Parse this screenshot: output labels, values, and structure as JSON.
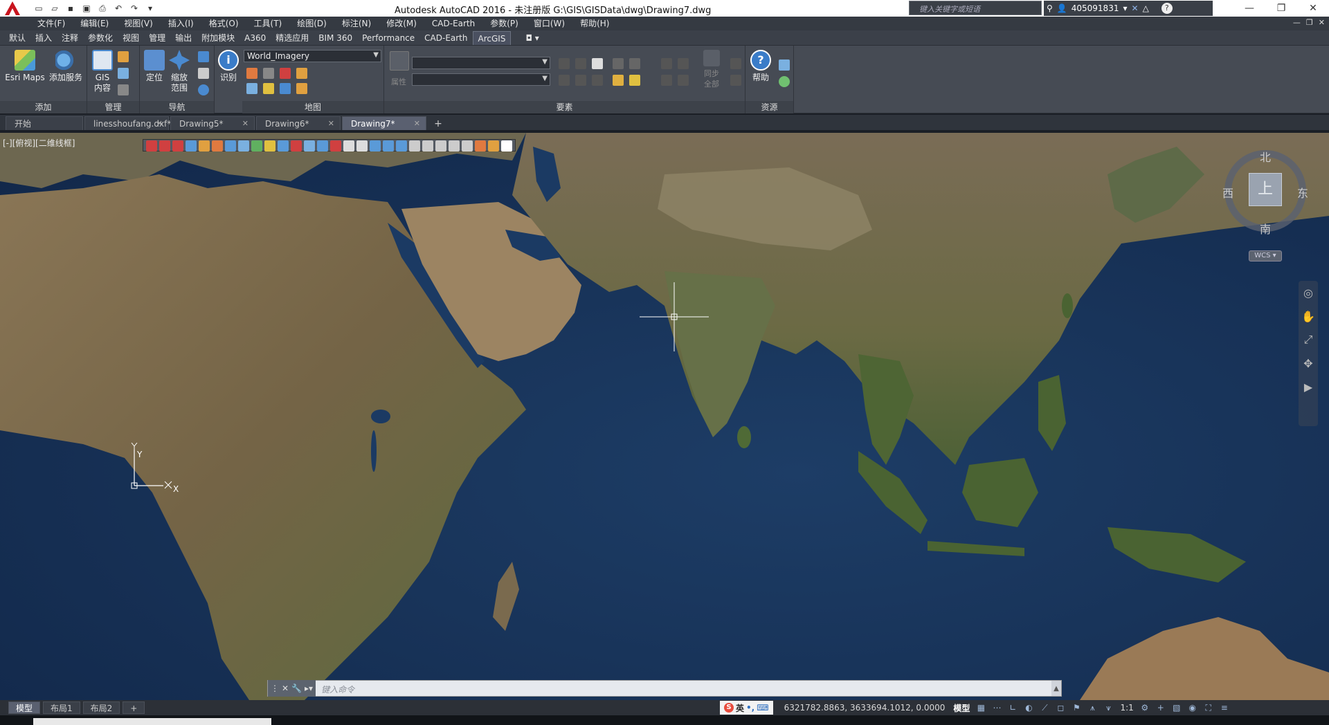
{
  "titlebar": {
    "title": "Autodesk AutoCAD 2016 - 未注册版    G:\\GIS\\GISData\\dwg\\Drawing7.dwg",
    "search_placeholder": "键入关键字或短语",
    "username": "405091831",
    "help_icon": "?"
  },
  "menubar": [
    "文件(F)",
    "编辑(E)",
    "视图(V)",
    "插入(I)",
    "格式(O)",
    "工具(T)",
    "绘图(D)",
    "标注(N)",
    "修改(M)",
    "CAD-Earth",
    "参数(P)",
    "窗口(W)",
    "帮助(H)"
  ],
  "ribbon_tabs": [
    "默认",
    "插入",
    "注释",
    "参数化",
    "视图",
    "管理",
    "输出",
    "附加模块",
    "A360",
    "精选应用",
    "BIM 360",
    "Performance",
    "CAD-Earth",
    "ArcGIS"
  ],
  "ribbon_active_tab": "ArcGIS",
  "ribbon": {
    "add_panel": {
      "title": "添加",
      "esri_maps": "Esri Maps",
      "add_service": "添加服务"
    },
    "manage_panel": {
      "title": "管理",
      "gis_content": "GIS\n内容"
    },
    "nav_panel": {
      "title": "导航",
      "locate": "定位",
      "zoom_extent": "缩放\n范围"
    },
    "identify": "识别",
    "map_panel": {
      "title": "地图",
      "basemap": "World_Imagery"
    },
    "features_panel": {
      "title": "要素",
      "attr_label": "属性",
      "sync_all": "同步\n全部"
    },
    "resources_panel": {
      "title": "资源",
      "help": "帮助"
    }
  },
  "file_tabs": [
    {
      "label": "开始",
      "active": false,
      "closable": false
    },
    {
      "label": "linesshoufang.dxf*",
      "active": false,
      "closable": true
    },
    {
      "label": "Drawing5*",
      "active": false,
      "closable": true
    },
    {
      "label": "Drawing6*",
      "active": false,
      "closable": true
    },
    {
      "label": "Drawing7*",
      "active": true,
      "closable": true
    }
  ],
  "viewport": {
    "label": "[-][俯视][二维线框]",
    "compass": {
      "north": "北",
      "south": "南",
      "east": "东",
      "west": "西",
      "top": "上",
      "wcs": "WCS"
    },
    "ucs": {
      "x": "X",
      "y": "Y"
    }
  },
  "command_line": {
    "placeholder": "键入命令"
  },
  "layout_tabs": [
    "模型",
    "布局1",
    "布局2"
  ],
  "layout_active": "模型",
  "status": {
    "ime_label": "英",
    "coords": "6321782.8863, 3633694.1012, 0.0000",
    "space": "模型",
    "scale": "1:1"
  },
  "colors": {
    "ocean": "#173257",
    "land": "#7a6a4e",
    "land_green": "#5d6b3f",
    "ui_dark": "#3b4049",
    "accent": "#5a6070"
  }
}
